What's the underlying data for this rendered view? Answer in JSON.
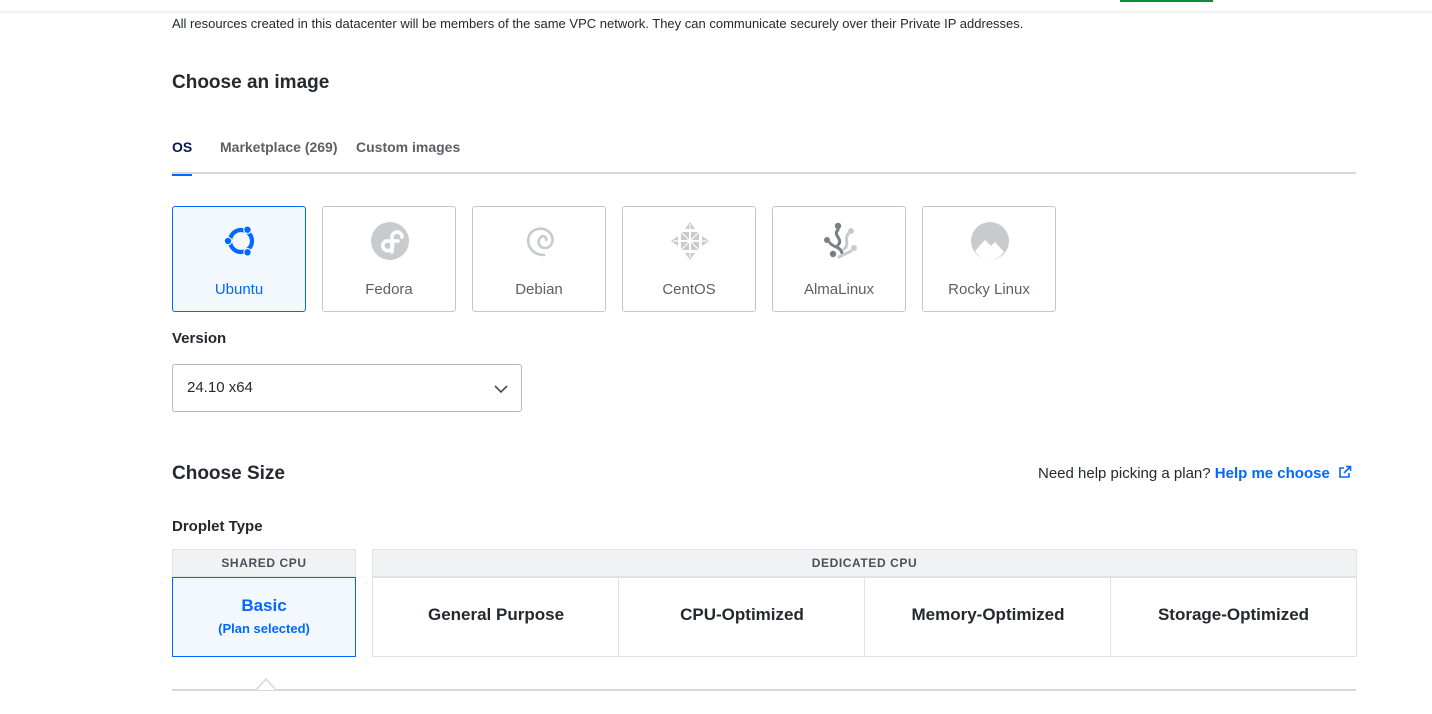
{
  "vpc_note": "All resources created in this datacenter will be members of the same VPC network. They can communicate securely over their Private IP addresses.",
  "image_section": {
    "title": "Choose an image",
    "tabs": [
      {
        "label": "OS",
        "active": true
      },
      {
        "label": "Marketplace (269)",
        "active": false
      },
      {
        "label": "Custom images",
        "active": false
      }
    ],
    "os_options": [
      {
        "label": "Ubuntu",
        "icon": "ubuntu-icon",
        "selected": true
      },
      {
        "label": "Fedora",
        "icon": "fedora-icon",
        "selected": false
      },
      {
        "label": "Debian",
        "icon": "debian-icon",
        "selected": false
      },
      {
        "label": "CentOS",
        "icon": "centos-icon",
        "selected": false
      },
      {
        "label": "AlmaLinux",
        "icon": "almalinux-icon",
        "selected": false
      },
      {
        "label": "Rocky Linux",
        "icon": "rocky-linux-icon",
        "selected": false
      }
    ],
    "version_label": "Version",
    "version_value": "24.10 x64"
  },
  "size_section": {
    "title": "Choose Size",
    "help_prompt": "Need help picking a plan?",
    "help_link": "Help me choose",
    "droplet_type_label": "Droplet Type",
    "shared_header": "SHARED CPU",
    "dedicated_header": "DEDICATED CPU",
    "basic_plan": {
      "label": "Basic",
      "sub": "(Plan selected)"
    },
    "dedicated_plans": [
      "General Purpose",
      "CPU-Optimized",
      "Memory-Optimized",
      "Storage-Optimized"
    ]
  },
  "colors": {
    "accent": "#0069ff",
    "selected_bg": "#f3f8ff",
    "border": "#c3c8ce",
    "top_bar_green": "#0d8a3b"
  }
}
